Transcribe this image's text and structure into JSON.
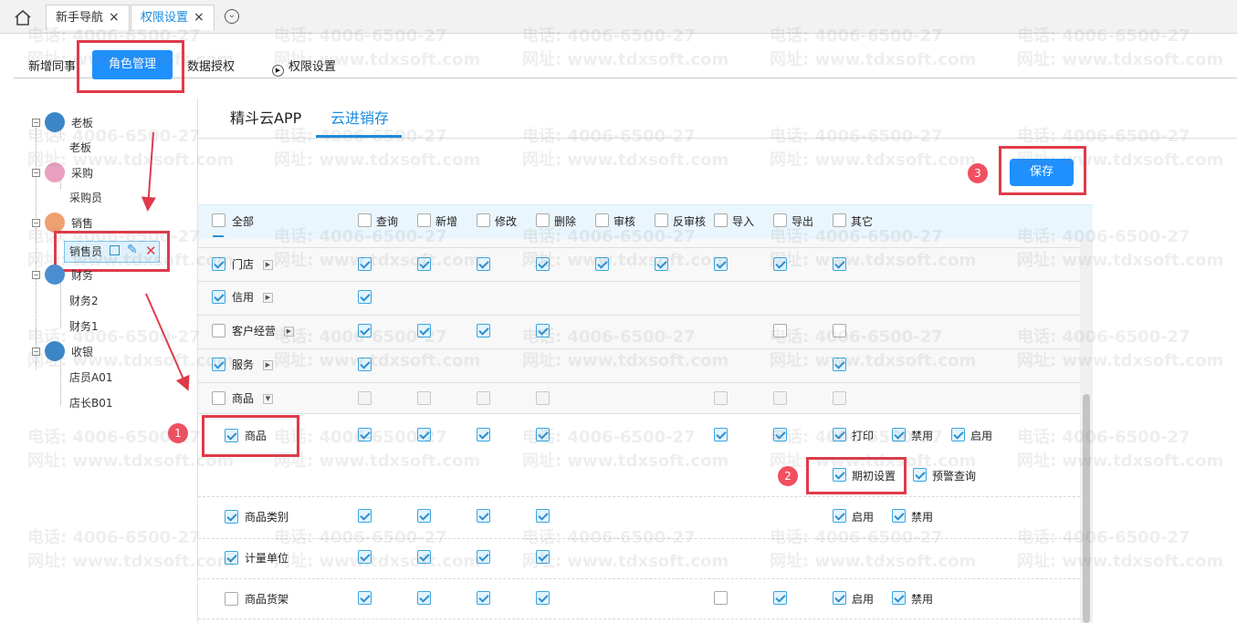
{
  "top_tabs": [
    {
      "label": "新手导航",
      "close": "×"
    },
    {
      "label": "权限设置",
      "close": "×"
    }
  ],
  "sub_nav": [
    "新增同事",
    "角色管理",
    "数据授权",
    "权限设置"
  ],
  "tree": {
    "groups": [
      "老板",
      "采购",
      "销售",
      "财务",
      "收银"
    ],
    "members": {
      "boss": [
        "老板"
      ],
      "purchase": [
        "采购员"
      ],
      "sales": [
        "销售员"
      ],
      "finance": [
        "财务2",
        "财务1"
      ],
      "cashier": [
        "店员A01",
        "店长B01"
      ]
    }
  },
  "product_tabs": [
    "精斗云APP",
    "云进销存"
  ],
  "save_label": "保存",
  "badges": [
    "1",
    "2",
    "3"
  ],
  "header": {
    "all": "全部",
    "cols": [
      "查询",
      "新增",
      "修改",
      "删除",
      "审核",
      "反审核",
      "导入",
      "导出",
      "其它"
    ]
  },
  "rows": [
    {
      "label": "门店"
    },
    {
      "label": "信用"
    },
    {
      "label": "客户经营"
    },
    {
      "label": "服务"
    },
    {
      "label": "商品"
    },
    {
      "label": "商品",
      "extras": [
        "打印",
        "禁用",
        "启用",
        "期初设置",
        "预警查询"
      ]
    },
    {
      "label": "商品类别",
      "extras": [
        "启用",
        "禁用"
      ]
    },
    {
      "label": "计量单位"
    },
    {
      "label": "商品货架",
      "extras": [
        "启用",
        "禁用"
      ]
    }
  ],
  "watermark": {
    "phone": "电话: 4006-6500-27",
    "site": "网址: www.tdxsoft.com"
  },
  "colors": {
    "accent": "#1e90ff",
    "highlight": "#e03a4a"
  }
}
